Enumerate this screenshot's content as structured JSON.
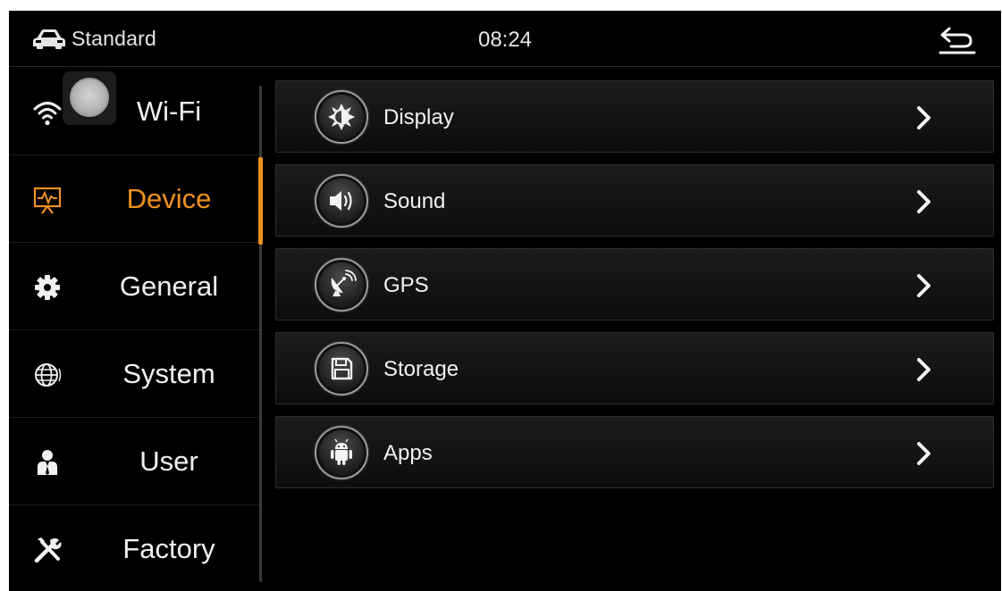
{
  "statusbar": {
    "mode_label": "Standard",
    "time": "08:24",
    "car_icon": "car-icon",
    "back_icon": "back-icon"
  },
  "sidebar": {
    "items": [
      {
        "label": "Wi-Fi",
        "icon": "wifi-icon",
        "active": false
      },
      {
        "label": "Device",
        "icon": "device-icon",
        "active": true
      },
      {
        "label": "General",
        "icon": "gear-icon",
        "active": false
      },
      {
        "label": "System",
        "icon": "globe-icon",
        "active": false
      },
      {
        "label": "User",
        "icon": "user-icon",
        "active": false
      },
      {
        "label": "Factory",
        "icon": "tools-icon",
        "active": false
      }
    ]
  },
  "content": {
    "items": [
      {
        "label": "Display",
        "icon": "brightness-icon"
      },
      {
        "label": "Sound",
        "icon": "speaker-icon"
      },
      {
        "label": "GPS",
        "icon": "satellite-dish-icon"
      },
      {
        "label": "Storage",
        "icon": "floppy-disk-icon"
      },
      {
        "label": "Apps",
        "icon": "android-icon"
      }
    ]
  },
  "colors": {
    "accent": "#f0921e",
    "background": "#000000",
    "text": "#f0f0f0"
  }
}
